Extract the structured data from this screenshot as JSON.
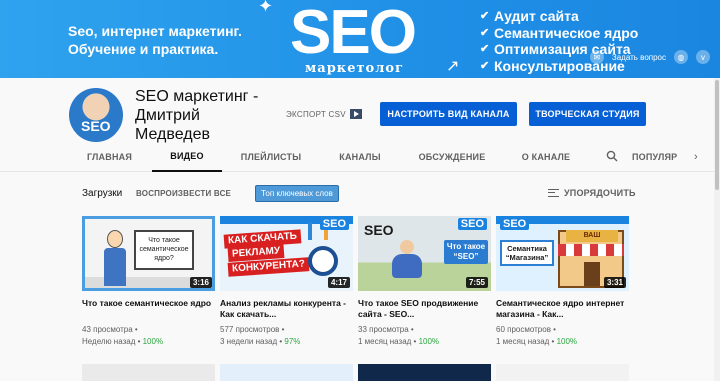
{
  "banner": {
    "tagline": [
      "Seo, интернет маркетинг.",
      "Обучение и практика."
    ],
    "logo_text": "SEO",
    "logo_sub": "маркетолог",
    "services": [
      "Аудит сайта",
      "Семантическое ядро",
      "Оптимизация сайта",
      "Консультирование"
    ],
    "links": {
      "ask": "Задать вопрос"
    },
    "icons": [
      "chat-icon",
      "globe-icon",
      "vk-icon"
    ]
  },
  "channel": {
    "name": "SEO маркетинг - Дмитрий Медведев",
    "avatar_text": "SEO",
    "export_label": "ЭКСПОРТ CSV",
    "customize_label": "НАСТРОИТЬ ВИД КАНАЛА",
    "studio_label": "ТВОРЧЕСКАЯ СТУДИЯ"
  },
  "tabs": [
    {
      "label": "ГЛАВНАЯ",
      "active": false
    },
    {
      "label": "ВИДЕО",
      "active": true
    },
    {
      "label": "ПЛЕЙЛИСТЫ",
      "active": false
    },
    {
      "label": "КАНАЛЫ",
      "active": false
    },
    {
      "label": "ОБСУЖДЕНИЕ",
      "active": false
    },
    {
      "label": "О КАНАЛЕ",
      "active": false
    },
    {
      "label": "ПОПУЛЯР",
      "active": false
    }
  ],
  "shelf": {
    "title": "Загрузки",
    "play_all": "ВОСПРОИЗВЕСТИ ВСЕ",
    "tag_button": "Топ ключевых слов",
    "sort_label": "УПОРЯДОЧИТЬ"
  },
  "videos": [
    {
      "title": "Что такое семантическое ядро",
      "views": "43 просмотра",
      "age": "Неделю назад",
      "percent": "100%",
      "duration": "3:16",
      "thumb_text": "Что такое семантическое ядро?"
    },
    {
      "title": "Анализ рекламы конкурента - Как скачать...",
      "views": "577 просмотров",
      "age": "3 недели назад",
      "percent": "97%",
      "duration": "4:17",
      "thumb_text": [
        "КАК СКАЧАТЬ",
        "РЕКЛАМУ",
        "КОНКУРЕНТА?"
      ]
    },
    {
      "title": "Что такое SEO продвижение сайта - SEO...",
      "views": "33 просмотра",
      "age": "1 месяц назад",
      "percent": "100%",
      "duration": "7:55",
      "thumb_text": [
        "SEO",
        "Что такое “SEO”"
      ]
    },
    {
      "title": "Семантическое ядро интернет магазина - Как...",
      "views": "60 просмотров",
      "age": "1 месяц назад",
      "percent": "100%",
      "duration": "3:31",
      "thumb_text": [
        "Семантика “Магазина”",
        "ВАШ МАГАЗИН"
      ]
    }
  ],
  "thumb_badge": "SEO",
  "colors": {
    "accent": "#065fd4",
    "banner": "#2196f3",
    "rating": "#2ba640"
  }
}
